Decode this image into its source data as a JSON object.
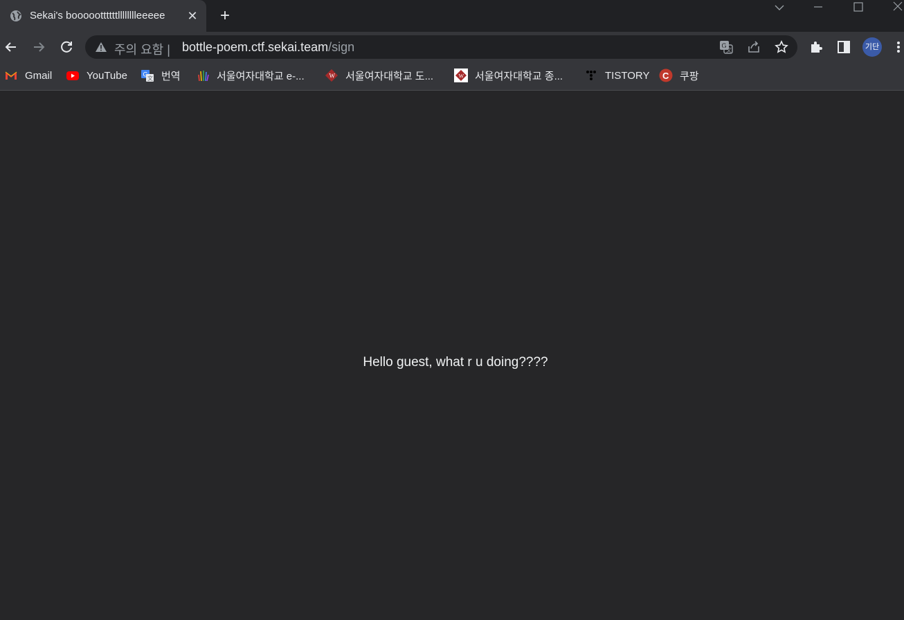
{
  "tab": {
    "title": "Sekai's booooottttttlllllllleeeee",
    "close_label": "✕",
    "new_tab_label": "+"
  },
  "toolbar": {
    "security_warning": "주의 요함",
    "separator": "|",
    "url_host": "bottle-poem.ctf.sekai.team",
    "url_path": "/sign",
    "profile_initials": "기단"
  },
  "bookmarks": [
    {
      "label": "Gmail",
      "icon": "gmail-icon"
    },
    {
      "label": "YouTube",
      "icon": "youtube-icon"
    },
    {
      "label": "번역",
      "icon": "translate-icon"
    },
    {
      "label": "서울여자대학교 e-...",
      "icon": "hand-icon"
    },
    {
      "label": "서울여자대학교 도...",
      "icon": "university-icon"
    },
    {
      "label": "서울여자대학교 종...",
      "icon": "university-icon"
    },
    {
      "label": "TISTORY",
      "icon": "tistory-icon"
    },
    {
      "label": "쿠팡",
      "icon": "coupang-icon"
    }
  ],
  "page": {
    "message": "Hello guest, what r u doing????"
  },
  "colors": {
    "page_bg": "#262628",
    "chrome_bg": "#35363a",
    "tabstrip_bg": "#202124",
    "profile_bg": "#3b5ba8"
  }
}
